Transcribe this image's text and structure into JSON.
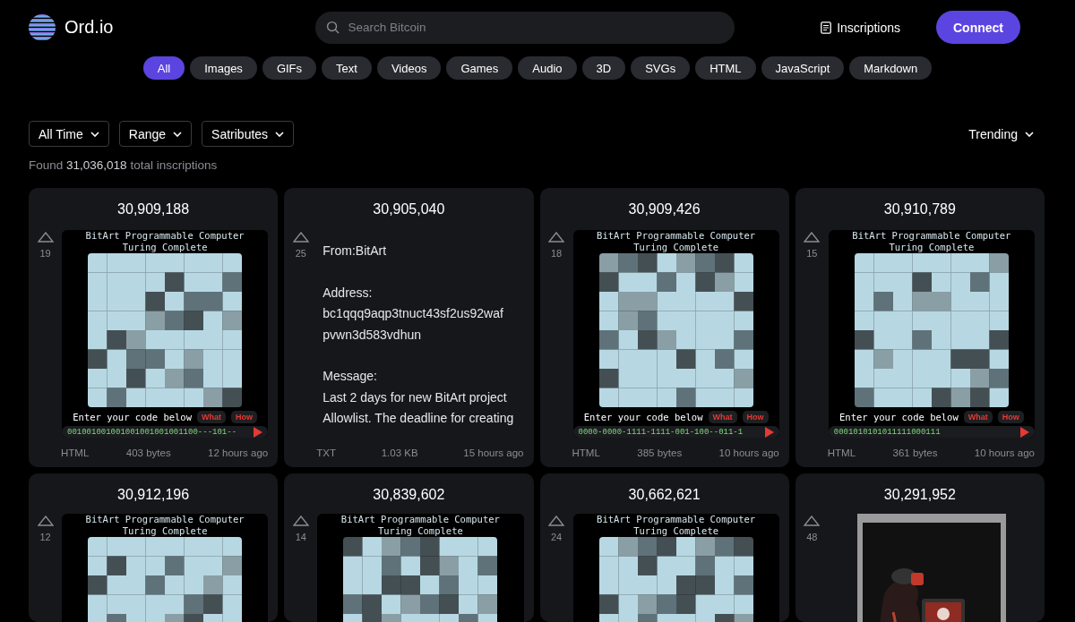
{
  "brand": {
    "name": "Ord.io"
  },
  "search": {
    "placeholder": "Search Bitcoin"
  },
  "nav": {
    "inscriptions": "Inscriptions",
    "connect": "Connect"
  },
  "categories": [
    {
      "label": "All",
      "selected": true
    },
    {
      "label": "Images",
      "selected": false
    },
    {
      "label": "GIFs",
      "selected": false
    },
    {
      "label": "Text",
      "selected": false
    },
    {
      "label": "Videos",
      "selected": false
    },
    {
      "label": "Games",
      "selected": false
    },
    {
      "label": "Audio",
      "selected": false
    },
    {
      "label": "3D",
      "selected": false
    },
    {
      "label": "SVGs",
      "selected": false
    },
    {
      "label": "HTML",
      "selected": false
    },
    {
      "label": "JavaScript",
      "selected": false
    },
    {
      "label": "Markdown",
      "selected": false
    }
  ],
  "filters": [
    "All Time",
    "Range",
    "Satributes"
  ],
  "sort": "Trending",
  "summary": {
    "prefix": "Found",
    "count": "31,036,018",
    "suffix": "total inscriptions"
  },
  "inscriptions": [
    {
      "number": "30,909,188",
      "votes": "19",
      "kind": "bitart",
      "title": [
        "BitArt Programmable Computer",
        "Turing Complete"
      ],
      "prompt": "Enter your code below",
      "what": "What",
      "how": "How",
      "code": "001001001001001001001001100---101--",
      "type": "HTML",
      "size": "403 bytes",
      "age": "12 hours ago"
    },
    {
      "number": "30,905,040",
      "votes": "25",
      "kind": "text",
      "blocks": [
        [
          "From:BitArt"
        ],
        [
          "Address:",
          "bc1qqq9aqp3tnuct43sf2us92waf",
          "pvwn3d583vdhun"
        ],
        [
          "Message:",
          "Last 2 days for new BitArt project",
          "Allowlist. The deadline for creating"
        ]
      ],
      "type": "TXT",
      "size": "1.03 KB",
      "age": "15 hours ago"
    },
    {
      "number": "30,909,426",
      "votes": "18",
      "kind": "bitart",
      "title": [
        "BitArt Programmable Computer",
        "Turing Complete"
      ],
      "prompt": "Enter your code below",
      "what": "What",
      "how": "How",
      "code": "0000-0000-1111-1111-001-100--011-1",
      "type": "HTML",
      "size": "385 bytes",
      "age": "10 hours ago"
    },
    {
      "number": "30,910,789",
      "votes": "15",
      "kind": "bitart",
      "title": [
        "BitArt Programmable Computer",
        "Turing Complete"
      ],
      "prompt": "Enter your code below",
      "what": "What",
      "how": "How",
      "code": "0001010101011111000111",
      "type": "HTML",
      "size": "361 bytes",
      "age": "10 hours ago"
    },
    {
      "number": "30,912,196",
      "votes": "12",
      "kind": "bitart",
      "title": [
        "BitArt Programmable Computer",
        "Turing Complete"
      ]
    },
    {
      "number": "30,839,602",
      "votes": "14",
      "kind": "bitart",
      "title": [
        "BitArt Programmable Computer",
        "Turing Complete"
      ]
    },
    {
      "number": "30,662,621",
      "votes": "24",
      "kind": "bitart",
      "title": [
        "BitArt Programmable Computer",
        "Turing Complete"
      ]
    },
    {
      "number": "30,291,952",
      "votes": "48",
      "kind": "picture"
    }
  ]
}
